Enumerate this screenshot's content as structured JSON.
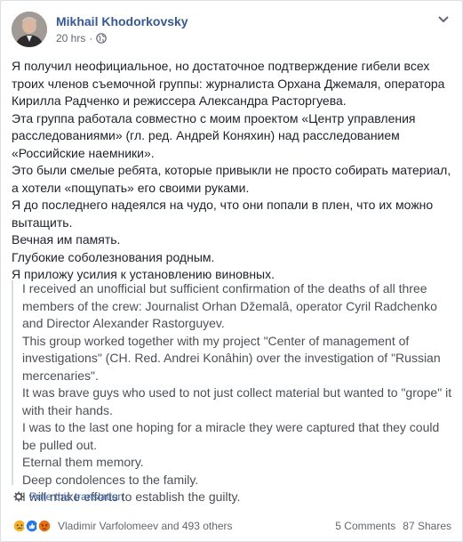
{
  "post": {
    "author": "Mikhail Khodorkovsky",
    "time": "20 hrs",
    "separator": "·",
    "body_lines": [
      "Я получил неофициальное, но достаточное подтверждение гибели всех троих членов съемочной группы: журналиста Орхана Джемаля, оператора Кирилла Радченко и режиссера Александра Расторгуева.",
      "Эта группа работала совместно с моим проектом «Центр управления расследованиями» (гл. ред. Андрей Коняхин) над расследованием «Российские наемники».",
      "Это были смелые ребята, которые привыкли не просто собирать материал, а хотели «пощупать» его своими руками.",
      "Я до последнего надеялся на чудо, что они попали в плен, что их можно вытащить.",
      "Вечная им память.",
      "Глубокие соболезнования родным.",
      "Я приложу усилия к установлению виновных."
    ],
    "translation_lines": [
      "I received an unofficial but sufficient confirmation of the deaths of all three members of the crew: Journalist Orhan Džemalâ, operator Cyril Radchenko and Director Alexander Rastorguyev.",
      "This group worked together with my project \"Center of management of investigations\" (CH. Red. Andrei Konâhin) over the investigation of \"Russian mercenaries\".",
      "It was brave guys who used to not just collect material but wanted to \"grope\" it with their hands.",
      "I was to the last one hoping for a miracle they were captured that they could be pulled out.",
      "Eternal them memory.",
      "Deep condolences to the family.",
      "I will make efforts to establish the guilty."
    ],
    "rate_translation": "Rate this translation"
  },
  "footer": {
    "reactors": "Vladimir Varfolomeev and 493 others",
    "comments": "5 Comments",
    "shares": "87 Shares",
    "reaction_icons": [
      "sad-icon",
      "like-icon",
      "angry-icon"
    ],
    "reaction_colors": [
      "#f7b125",
      "#2078f4",
      "#e9710f"
    ]
  },
  "icons": {
    "globe": "globe-icon",
    "chevron": "chevron-down-icon",
    "gear": "gear-icon"
  }
}
